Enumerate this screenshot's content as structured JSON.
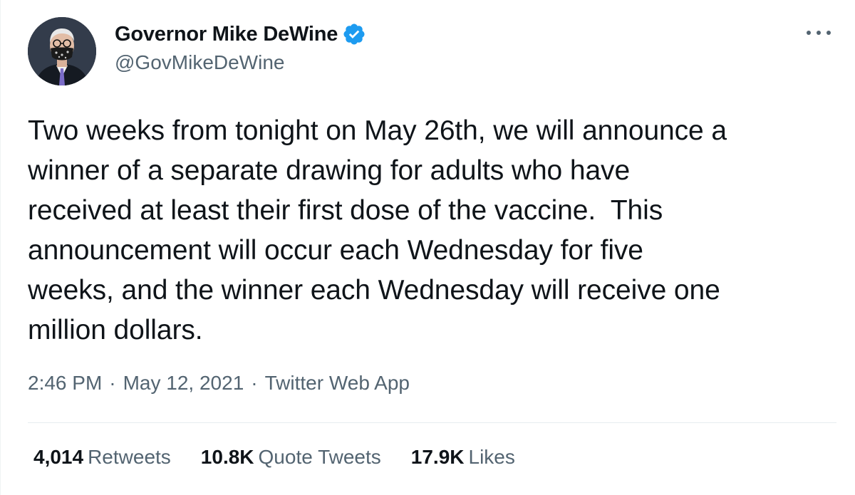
{
  "author": {
    "display_name": "Governor Mike DeWine",
    "handle": "@GovMikeDeWine",
    "verified": true,
    "verified_color": "#1d9bf0"
  },
  "tweet": {
    "text": "Two weeks from tonight on May 26th, we will announce a\nwinner of a separate drawing for adults who have\nreceived at least their first dose of the vaccine.  This\nannouncement will occur each Wednesday for five\nweeks, and the winner each Wednesday will receive one\nmillion dollars.",
    "time": "2:46 PM",
    "date": "May 12, 2021",
    "source": "Twitter Web App",
    "separator": "·"
  },
  "stats": {
    "retweets_count": "4,014",
    "retweets_label": "Retweets",
    "quotes_count": "10.8K",
    "quotes_label": "Quote Tweets",
    "likes_count": "17.9K",
    "likes_label": "Likes"
  },
  "icons": {
    "verified": "verified-badge-icon",
    "more": "more-horizontal-icon"
  }
}
